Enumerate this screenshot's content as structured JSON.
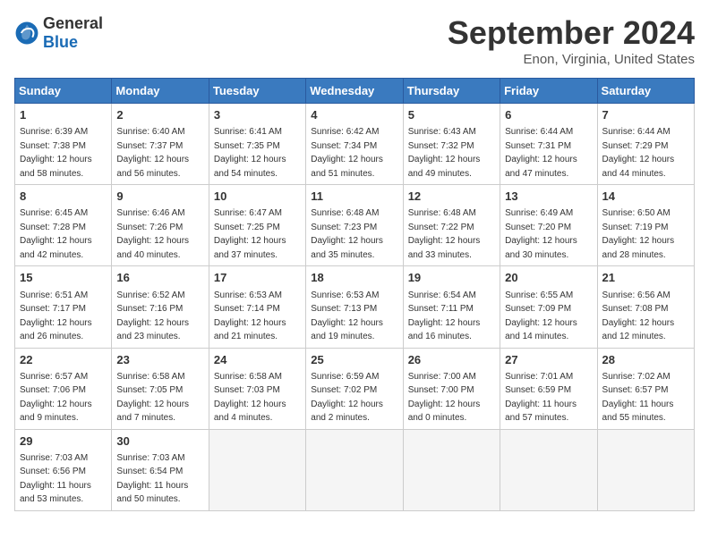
{
  "header": {
    "logo_general": "General",
    "logo_blue": "Blue",
    "month_year": "September 2024",
    "location": "Enon, Virginia, United States"
  },
  "weekdays": [
    "Sunday",
    "Monday",
    "Tuesday",
    "Wednesday",
    "Thursday",
    "Friday",
    "Saturday"
  ],
  "weeks": [
    [
      {
        "day": "1",
        "sunrise": "6:39 AM",
        "sunset": "7:38 PM",
        "daylight": "12 hours and 58 minutes."
      },
      {
        "day": "2",
        "sunrise": "6:40 AM",
        "sunset": "7:37 PM",
        "daylight": "12 hours and 56 minutes."
      },
      {
        "day": "3",
        "sunrise": "6:41 AM",
        "sunset": "7:35 PM",
        "daylight": "12 hours and 54 minutes."
      },
      {
        "day": "4",
        "sunrise": "6:42 AM",
        "sunset": "7:34 PM",
        "daylight": "12 hours and 51 minutes."
      },
      {
        "day": "5",
        "sunrise": "6:43 AM",
        "sunset": "7:32 PM",
        "daylight": "12 hours and 49 minutes."
      },
      {
        "day": "6",
        "sunrise": "6:44 AM",
        "sunset": "7:31 PM",
        "daylight": "12 hours and 47 minutes."
      },
      {
        "day": "7",
        "sunrise": "6:44 AM",
        "sunset": "7:29 PM",
        "daylight": "12 hours and 44 minutes."
      }
    ],
    [
      {
        "day": "8",
        "sunrise": "6:45 AM",
        "sunset": "7:28 PM",
        "daylight": "12 hours and 42 minutes."
      },
      {
        "day": "9",
        "sunrise": "6:46 AM",
        "sunset": "7:26 PM",
        "daylight": "12 hours and 40 minutes."
      },
      {
        "day": "10",
        "sunrise": "6:47 AM",
        "sunset": "7:25 PM",
        "daylight": "12 hours and 37 minutes."
      },
      {
        "day": "11",
        "sunrise": "6:48 AM",
        "sunset": "7:23 PM",
        "daylight": "12 hours and 35 minutes."
      },
      {
        "day": "12",
        "sunrise": "6:48 AM",
        "sunset": "7:22 PM",
        "daylight": "12 hours and 33 minutes."
      },
      {
        "day": "13",
        "sunrise": "6:49 AM",
        "sunset": "7:20 PM",
        "daylight": "12 hours and 30 minutes."
      },
      {
        "day": "14",
        "sunrise": "6:50 AM",
        "sunset": "7:19 PM",
        "daylight": "12 hours and 28 minutes."
      }
    ],
    [
      {
        "day": "15",
        "sunrise": "6:51 AM",
        "sunset": "7:17 PM",
        "daylight": "12 hours and 26 minutes."
      },
      {
        "day": "16",
        "sunrise": "6:52 AM",
        "sunset": "7:16 PM",
        "daylight": "12 hours and 23 minutes."
      },
      {
        "day": "17",
        "sunrise": "6:53 AM",
        "sunset": "7:14 PM",
        "daylight": "12 hours and 21 minutes."
      },
      {
        "day": "18",
        "sunrise": "6:53 AM",
        "sunset": "7:13 PM",
        "daylight": "12 hours and 19 minutes."
      },
      {
        "day": "19",
        "sunrise": "6:54 AM",
        "sunset": "7:11 PM",
        "daylight": "12 hours and 16 minutes."
      },
      {
        "day": "20",
        "sunrise": "6:55 AM",
        "sunset": "7:09 PM",
        "daylight": "12 hours and 14 minutes."
      },
      {
        "day": "21",
        "sunrise": "6:56 AM",
        "sunset": "7:08 PM",
        "daylight": "12 hours and 12 minutes."
      }
    ],
    [
      {
        "day": "22",
        "sunrise": "6:57 AM",
        "sunset": "7:06 PM",
        "daylight": "12 hours and 9 minutes."
      },
      {
        "day": "23",
        "sunrise": "6:58 AM",
        "sunset": "7:05 PM",
        "daylight": "12 hours and 7 minutes."
      },
      {
        "day": "24",
        "sunrise": "6:58 AM",
        "sunset": "7:03 PM",
        "daylight": "12 hours and 4 minutes."
      },
      {
        "day": "25",
        "sunrise": "6:59 AM",
        "sunset": "7:02 PM",
        "daylight": "12 hours and 2 minutes."
      },
      {
        "day": "26",
        "sunrise": "7:00 AM",
        "sunset": "7:00 PM",
        "daylight": "12 hours and 0 minutes."
      },
      {
        "day": "27",
        "sunrise": "7:01 AM",
        "sunset": "6:59 PM",
        "daylight": "11 hours and 57 minutes."
      },
      {
        "day": "28",
        "sunrise": "7:02 AM",
        "sunset": "6:57 PM",
        "daylight": "11 hours and 55 minutes."
      }
    ],
    [
      {
        "day": "29",
        "sunrise": "7:03 AM",
        "sunset": "6:56 PM",
        "daylight": "11 hours and 53 minutes."
      },
      {
        "day": "30",
        "sunrise": "7:03 AM",
        "sunset": "6:54 PM",
        "daylight": "11 hours and 50 minutes."
      },
      null,
      null,
      null,
      null,
      null
    ]
  ]
}
